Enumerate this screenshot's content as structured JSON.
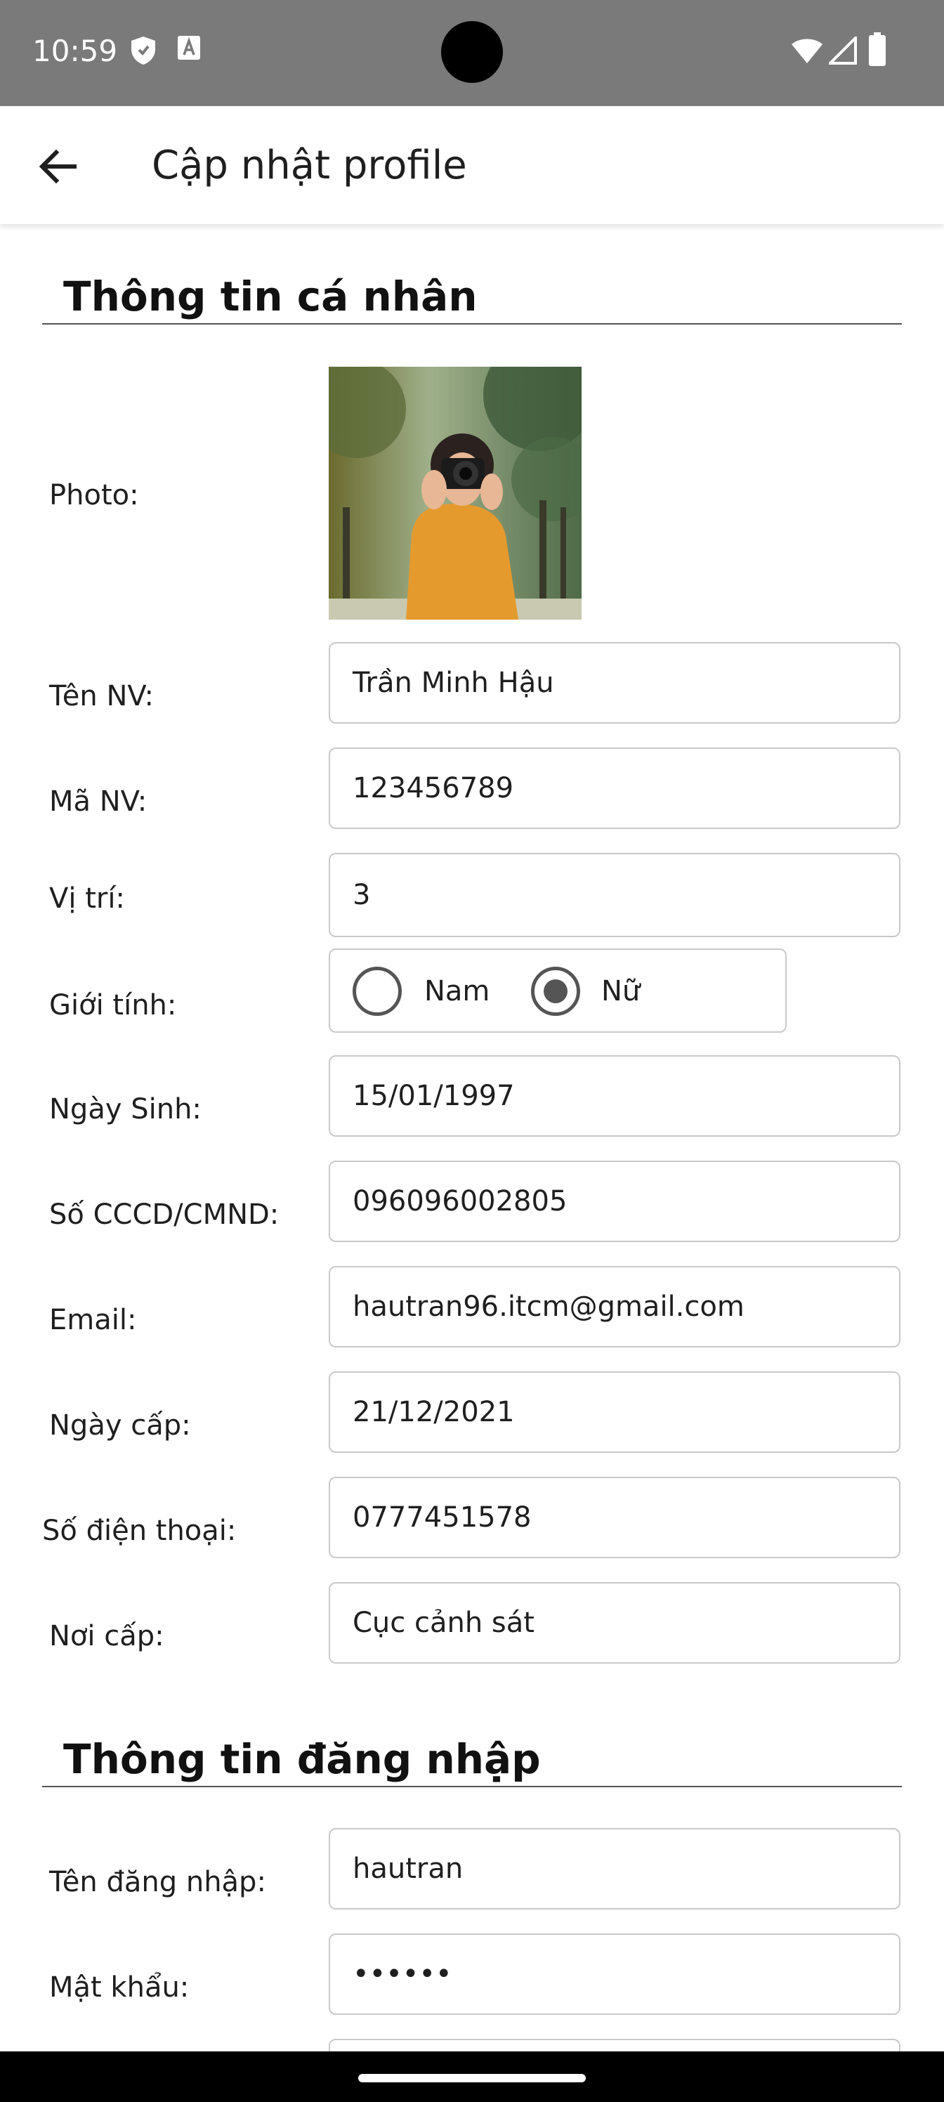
{
  "status": {
    "time": "10:59"
  },
  "app_bar": {
    "title": "Cập nhật profile"
  },
  "personal": {
    "title": "Thông tin cá nhân",
    "photo_label": "Photo:",
    "fields": [
      {
        "label": "Tên NV:",
        "value": "Trần Minh Hậu"
      },
      {
        "label": "Mã NV:",
        "value": "123456789"
      },
      {
        "label": "Vị trí:",
        "value": "3"
      }
    ],
    "gender": {
      "label": "Giới tính:",
      "options": [
        "Nam",
        "Nữ"
      ],
      "selected": "Nữ"
    },
    "fields2": [
      {
        "label": "Ngày Sinh:",
        "value": "15/01/1997"
      },
      {
        "label": "Số CCCD/CMND:",
        "value": "096096002805"
      },
      {
        "label": "Email:",
        "value": "hautran96.itcm@gmail.com"
      },
      {
        "label": "Ngày cấp:",
        "value": "21/12/2021"
      },
      {
        "label": "Số điện thoại:",
        "value": "0777451578"
      },
      {
        "label": "Nơi cấp:",
        "value": "Cục cảnh sát"
      }
    ]
  },
  "login": {
    "title": "Thông tin đăng nhập",
    "fields": [
      {
        "label": "Tên đăng nhập:",
        "value": "hautran"
      },
      {
        "label": "Mật khẩu:",
        "value": "••••••"
      }
    ]
  },
  "colors": {
    "status_bar": "#7a7a7a",
    "border": "#c9c9c9",
    "radio": "#555555"
  }
}
